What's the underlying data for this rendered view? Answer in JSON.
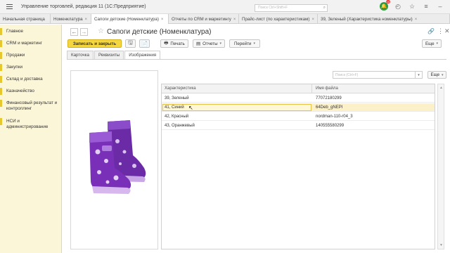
{
  "window": {
    "app_title": "Управление торговлей, редакция 11   (1С:Предприятие)",
    "search_placeholder": "Поиск Ctrl+Shift+F",
    "notification_count": "10"
  },
  "open_tabs": [
    {
      "label": "Начальная страница",
      "active": false
    },
    {
      "label": "Номенклатура",
      "active": false
    },
    {
      "label": "Сапоги детские (Номенклатура)",
      "active": true
    },
    {
      "label": "Отчеты по CRM и маркетингу",
      "active": false
    },
    {
      "label": "Прайс-лист (по характеристикам)",
      "active": false
    },
    {
      "label": "39, Зеленый (Характеристика номенклатуры)",
      "active": false
    }
  ],
  "sidebar": {
    "items": [
      {
        "label": "Главное"
      },
      {
        "label": "CRM и маркетинг"
      },
      {
        "label": "Продажи"
      },
      {
        "label": "Закупки"
      },
      {
        "label": "Склад и доставка"
      },
      {
        "label": "Казначейство"
      },
      {
        "label": "Финансовый результат и контроллинг"
      },
      {
        "label": "НСИ и администрирование"
      }
    ]
  },
  "form": {
    "title": "Сапоги детские (Номенклатура)",
    "toolbar": {
      "save_close": "Записать и закрыть",
      "print": "Печать",
      "reports": "Отчеты",
      "goto": "Перейти",
      "more": "Еще"
    },
    "tabs": [
      {
        "label": "Карточка",
        "active": false
      },
      {
        "label": "Реквизиты",
        "active": false
      },
      {
        "label": "Изображения",
        "active": true
      }
    ],
    "images": {
      "search_placeholder": "Поиск (Ctrl+F)",
      "more": "Еще",
      "columns": [
        "Характеристика",
        "Имя файла"
      ],
      "rows": [
        {
          "characteristic": "39, Зеленый",
          "file": "77072180299",
          "selected": false
        },
        {
          "characteristic": "41, Синий",
          "file": "64Deb_gNEPI",
          "selected": true
        },
        {
          "characteristic": "42, Красный",
          "file": "nordman-110-r04_3",
          "selected": false
        },
        {
          "characteristic": "43, Оранжевый",
          "file": "140555580299",
          "selected": false
        }
      ]
    }
  },
  "colors": {
    "accent_yellow": "#f5d63d",
    "sidebar_bg": "#fcf6d9",
    "selected_row": "#fbf0c8",
    "boot_purple": "#7a2fb8"
  }
}
